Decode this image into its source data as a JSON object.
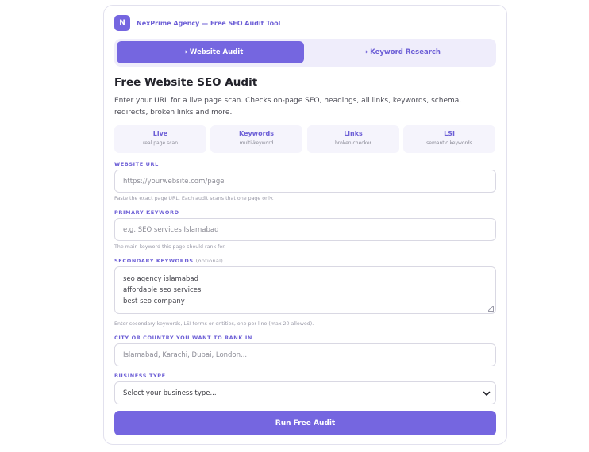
{
  "brand": {
    "logo_letter": "N",
    "name": "NexPrime Agency — Free SEO Audit Tool"
  },
  "tabs": [
    {
      "label": "⟶ Website Audit",
      "active": true
    },
    {
      "label": "⟶ Keyword Research",
      "active": false
    }
  ],
  "main": {
    "title": "Free Website SEO Audit",
    "description": "Enter your URL for a live page scan. Checks on-page SEO, headings, all links, keywords, schema, redirects, broken links and more."
  },
  "features": [
    {
      "title": "Live",
      "sub": "real page scan"
    },
    {
      "title": "Keywords",
      "sub": "multi-keyword"
    },
    {
      "title": "Links",
      "sub": "broken checker"
    },
    {
      "title": "LSI",
      "sub": "semantic keywords"
    }
  ],
  "form": {
    "url": {
      "label": "WEBSITE URL",
      "placeholder": "https://yourwebsite.com/page",
      "hint": "Paste the exact page URL. Each audit scans that one page only."
    },
    "primary": {
      "label": "PRIMARY KEYWORD",
      "placeholder": "e.g. SEO services Islamabad",
      "hint": "The main keyword this page should rank for."
    },
    "secondary": {
      "label": "SECONDARY KEYWORDS",
      "optional": "(optional)",
      "value": "seo agency islamabad\naffordable seo services\nbest seo company",
      "hint": "Enter secondary keywords, LSI terms or entities, one per line (max 20 allowed)."
    },
    "city": {
      "label": "CITY OR COUNTRY YOU WANT TO RANK IN",
      "placeholder": "Islamabad, Karachi, Dubai, London..."
    },
    "business": {
      "label": "BUSINESS TYPE",
      "selected": "Select your business type..."
    }
  },
  "run_button": "Run Free Audit",
  "colors": {
    "accent": "#7566e0",
    "accent_text": "#6d5fd6",
    "tab_bg": "#efedfb",
    "feature_bg": "#f5f4fc"
  }
}
